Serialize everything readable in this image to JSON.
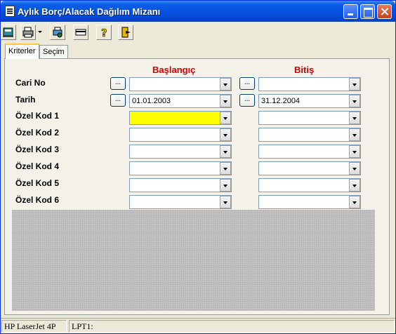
{
  "window": {
    "title": "Aylık Borç/Alacak Dağılım Mizanı"
  },
  "toolbar": {
    "icons": [
      "preview-icon",
      "printer-icon",
      "printer-setup-icon",
      "card-icon",
      "help-icon",
      "exit-icon"
    ]
  },
  "tabs": [
    {
      "label": "Kriterler",
      "active": true
    },
    {
      "label": "Seçim",
      "active": false
    }
  ],
  "headers": {
    "start": "Başlangıç",
    "end": "Bitiş"
  },
  "ellipsis": "...",
  "rows": [
    {
      "label": "Cari No",
      "start": "",
      "end": ""
    },
    {
      "label": "Tarih",
      "start": "01.01.2003",
      "end": "31.12.2004"
    },
    {
      "label": "Özel Kod 1",
      "start": "",
      "end": ""
    },
    {
      "label": "Özel Kod 2",
      "start": "",
      "end": ""
    },
    {
      "label": "Özel Kod 3",
      "start": "",
      "end": ""
    },
    {
      "label": "Özel Kod 4",
      "start": "",
      "end": ""
    },
    {
      "label": "Özel Kod 5",
      "start": "",
      "end": ""
    },
    {
      "label": "Özel Kod 6",
      "start": "",
      "end": ""
    }
  ],
  "colors": {
    "header": "#cc0000",
    "highlight": "#ffff00"
  },
  "status": {
    "printer": "HP LaserJet 4P",
    "port": "LPT1:"
  }
}
